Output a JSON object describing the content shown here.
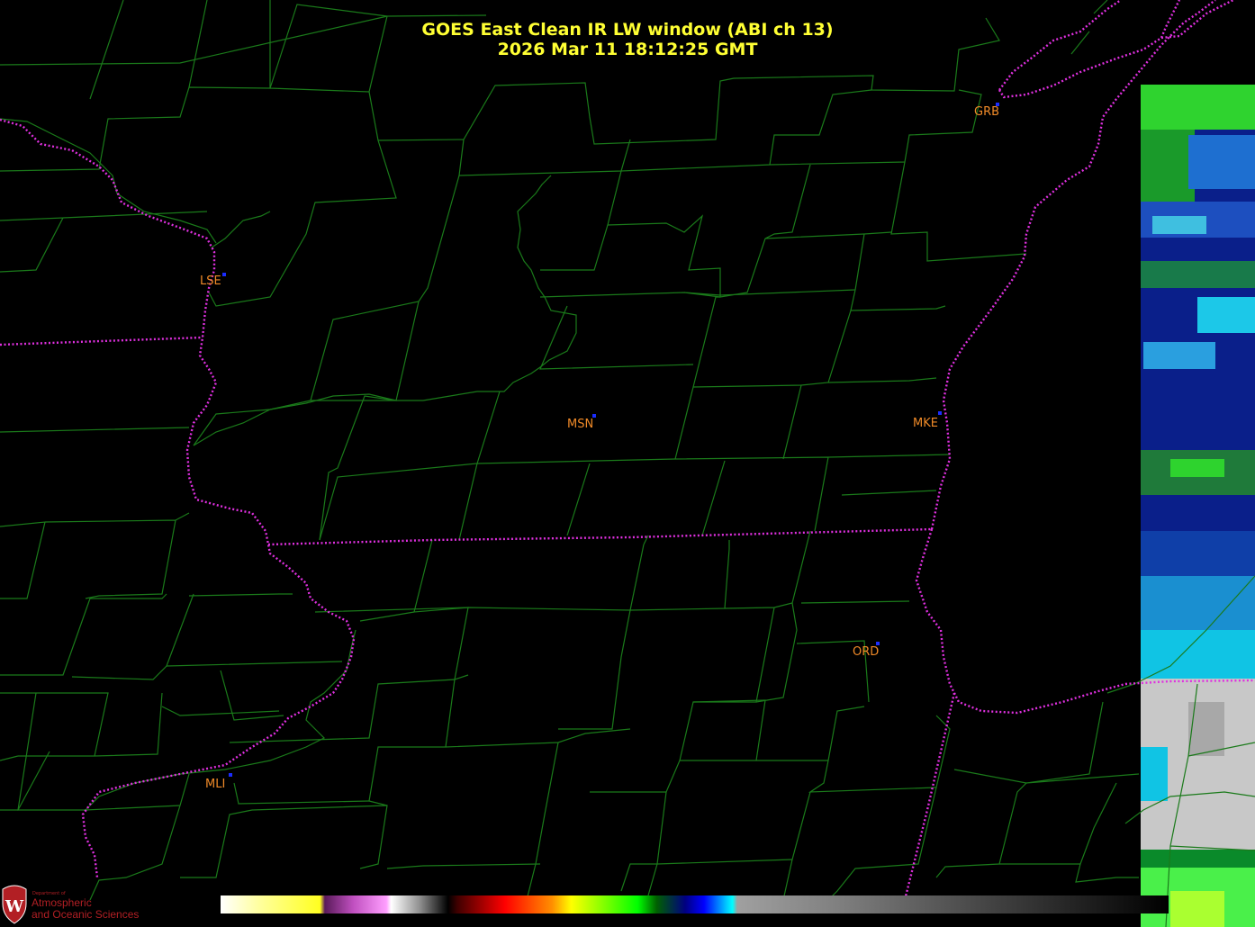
{
  "title": {
    "line1": "GOES East Clean IR LW window (ABI ch 13)",
    "line2": "2026 Mar 11  18:12:25 GMT"
  },
  "stations": [
    {
      "id": "GRB"
    },
    {
      "id": "LSE"
    },
    {
      "id": "MSN"
    },
    {
      "id": "MKE"
    },
    {
      "id": "ORD"
    },
    {
      "id": "MLI"
    }
  ],
  "logo": {
    "small": "Department of",
    "line1": "Atmospheric",
    "line2": "and Oceanic Sciences"
  },
  "colors": {
    "county_lines": "#1a7a1a",
    "state_borders": "#e030e0",
    "title": "#ffff33",
    "station_labels": "#f08a28",
    "station_dots": "#1a2cff",
    "logo": "#b21f24"
  }
}
